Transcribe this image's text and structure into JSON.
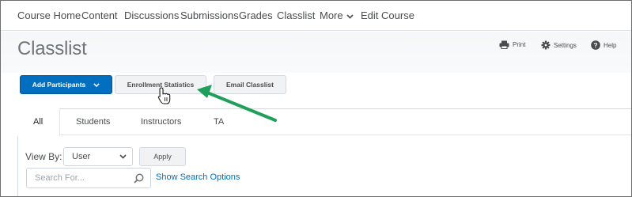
{
  "nav": {
    "items": [
      "Course Home",
      "Content",
      "Discussions",
      "Submissions",
      "Grades",
      "Classlist"
    ],
    "more_label": "More",
    "edit_label": "Edit Course"
  },
  "page": {
    "title": "Classlist"
  },
  "utilities": {
    "print": "Print",
    "settings": "Settings",
    "help": "Help"
  },
  "toolbar": {
    "add_participants": "Add Participants",
    "enrollment_statistics": "Enrollment Statistics",
    "email_classlist": "Email Classlist"
  },
  "tabs": [
    "All",
    "Students",
    "Instructors",
    "TA"
  ],
  "filters": {
    "view_by_label": "View By:",
    "view_by_value": "User",
    "apply": "Apply",
    "search_placeholder": "Search For...",
    "show_search_options": "Show Search Options"
  },
  "colors": {
    "primary": "#006fbf",
    "annotation_arrow": "#1fa05a"
  }
}
